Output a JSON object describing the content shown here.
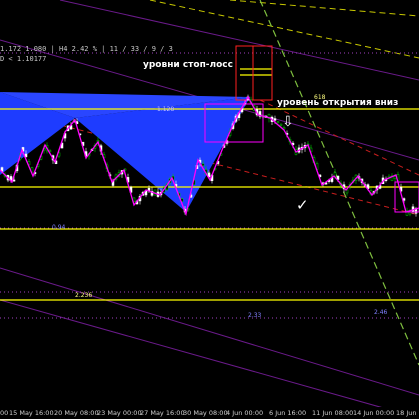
{
  "header": {
    "info_line": "1.172   1.080  |  H4  2.42 %  |  11 / 33 / 9 / 3",
    "info_line2": "D  < 1.10177"
  },
  "annotations": {
    "stop_loss": "уровни стоп-лосс",
    "open_level": "уровень открытия вниз",
    "check": "✓",
    "arrow": "⇩"
  },
  "fib_labels": {
    "l618": "618",
    "l1128": "1.128",
    "l094": "0.94",
    "l2236": "2.236",
    "l233": "2.33",
    "l246": "2.46"
  },
  "xaxis": {
    "ticks": [
      "00",
      "15 May 16:00",
      "20 May 08:00",
      "23 May 00:00",
      "27 May 16:00",
      "30 May 08:00",
      "4 Jun 00:00",
      "6 Jun 16:00",
      "11 Jun 08:00",
      "14 Jun 00:00",
      "18 Jun"
    ]
  },
  "colors": {
    "background": "#000000",
    "harmonic_fill": "#1e3cff",
    "yellow_lines": "#ffff00",
    "zigzag": "#ff00ff",
    "candles_up": "#00c800",
    "candles_down": "#ffffff",
    "stop_box": "#ff2020",
    "trend_green": "#7fbf3f",
    "channel_purple": "#7a1a9a",
    "dashed_red": "#c81e1e"
  }
}
